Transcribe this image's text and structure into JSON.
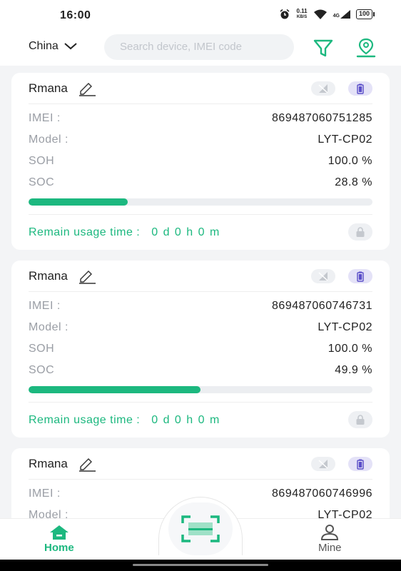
{
  "status_bar": {
    "time": "16:00",
    "net_speed": "0.11",
    "net_unit": "KB/S",
    "signal": "4G",
    "battery": "100"
  },
  "header": {
    "region": "China",
    "search_placeholder": "Search device, IMEI code"
  },
  "labels": {
    "imei": "IMEI :",
    "model": "Model :",
    "soh": "SOH",
    "soc": "SOC",
    "remain": "Remain usage time :"
  },
  "devices": [
    {
      "name": "Rmana",
      "imei": "869487060751285",
      "model": "LYT-CP02",
      "soh": "100.0 %",
      "soc": "28.8 %",
      "soc_value": 28.8,
      "remain": "0 d 0 h 0 m"
    },
    {
      "name": "Rmana",
      "imei": "869487060746731",
      "model": "LYT-CP02",
      "soh": "100.0 %",
      "soc": "49.9 %",
      "soc_value": 49.9,
      "remain": "0 d 0 h 0 m"
    },
    {
      "name": "Rmana",
      "imei": "869487060746996",
      "model": "LYT-CP02"
    }
  ],
  "tabbar": {
    "home": "Home",
    "mine": "Mine"
  },
  "colors": {
    "accent": "#1cb87f",
    "battery_badge": "#5b4fc9"
  }
}
